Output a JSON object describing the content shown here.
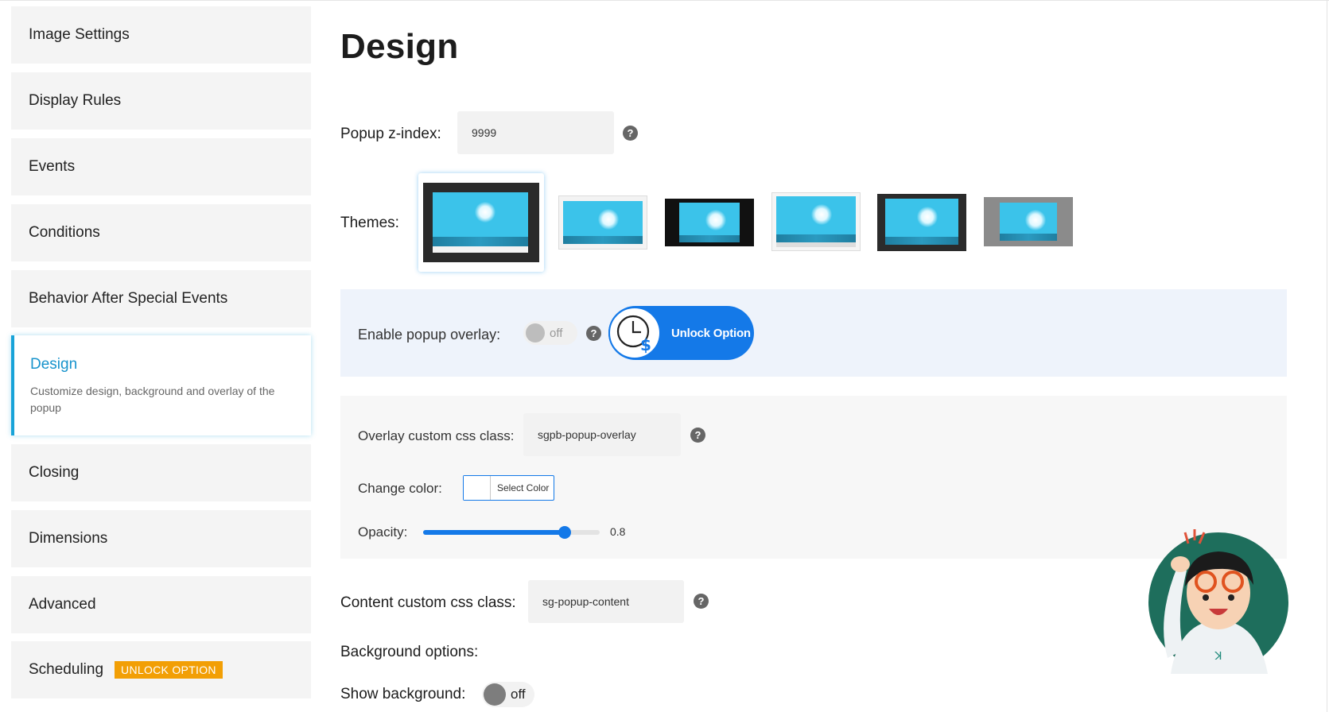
{
  "sidebar": {
    "items": [
      {
        "label": "Image Settings"
      },
      {
        "label": "Display Rules"
      },
      {
        "label": "Events"
      },
      {
        "label": "Conditions"
      },
      {
        "label": "Behavior After Special Events"
      },
      {
        "label": "Design",
        "description": "Customize design, background and overlay of the popup"
      },
      {
        "label": "Closing"
      },
      {
        "label": "Dimensions"
      },
      {
        "label": "Advanced"
      },
      {
        "label": "Scheduling",
        "badge": "UNLOCK OPTION"
      }
    ]
  },
  "main": {
    "title": "Design",
    "zindex": {
      "label": "Popup z-index:",
      "value": "9999"
    },
    "themes": {
      "label": "Themes:",
      "selected_index": 0
    },
    "overlay": {
      "label": "Enable popup overlay:",
      "toggle_text": "off",
      "unlock_label": "Unlock Option",
      "css_class_label": "Overlay custom css class:",
      "css_class_value": "sgpb-popup-overlay",
      "color_label": "Change color:",
      "color_button": "Select Color",
      "opacity_label": "Opacity:",
      "opacity_value": "0.8"
    },
    "content_css": {
      "label": "Content custom css class:",
      "value": "sg-popup-content"
    },
    "background": {
      "heading": "Background options:",
      "show_label": "Show background:",
      "toggle_text": "off"
    },
    "help_glyph": "?"
  },
  "colors": {
    "accent": "#1479e8",
    "active_border": "#18a3d8",
    "badge": "#f29f05",
    "sidebar_bg": "#f4f4f4",
    "overlay_row_bg": "#eef3fb"
  },
  "icons": [
    "help-icon",
    "clock-dollar-icon",
    "mascot-illustration"
  ]
}
